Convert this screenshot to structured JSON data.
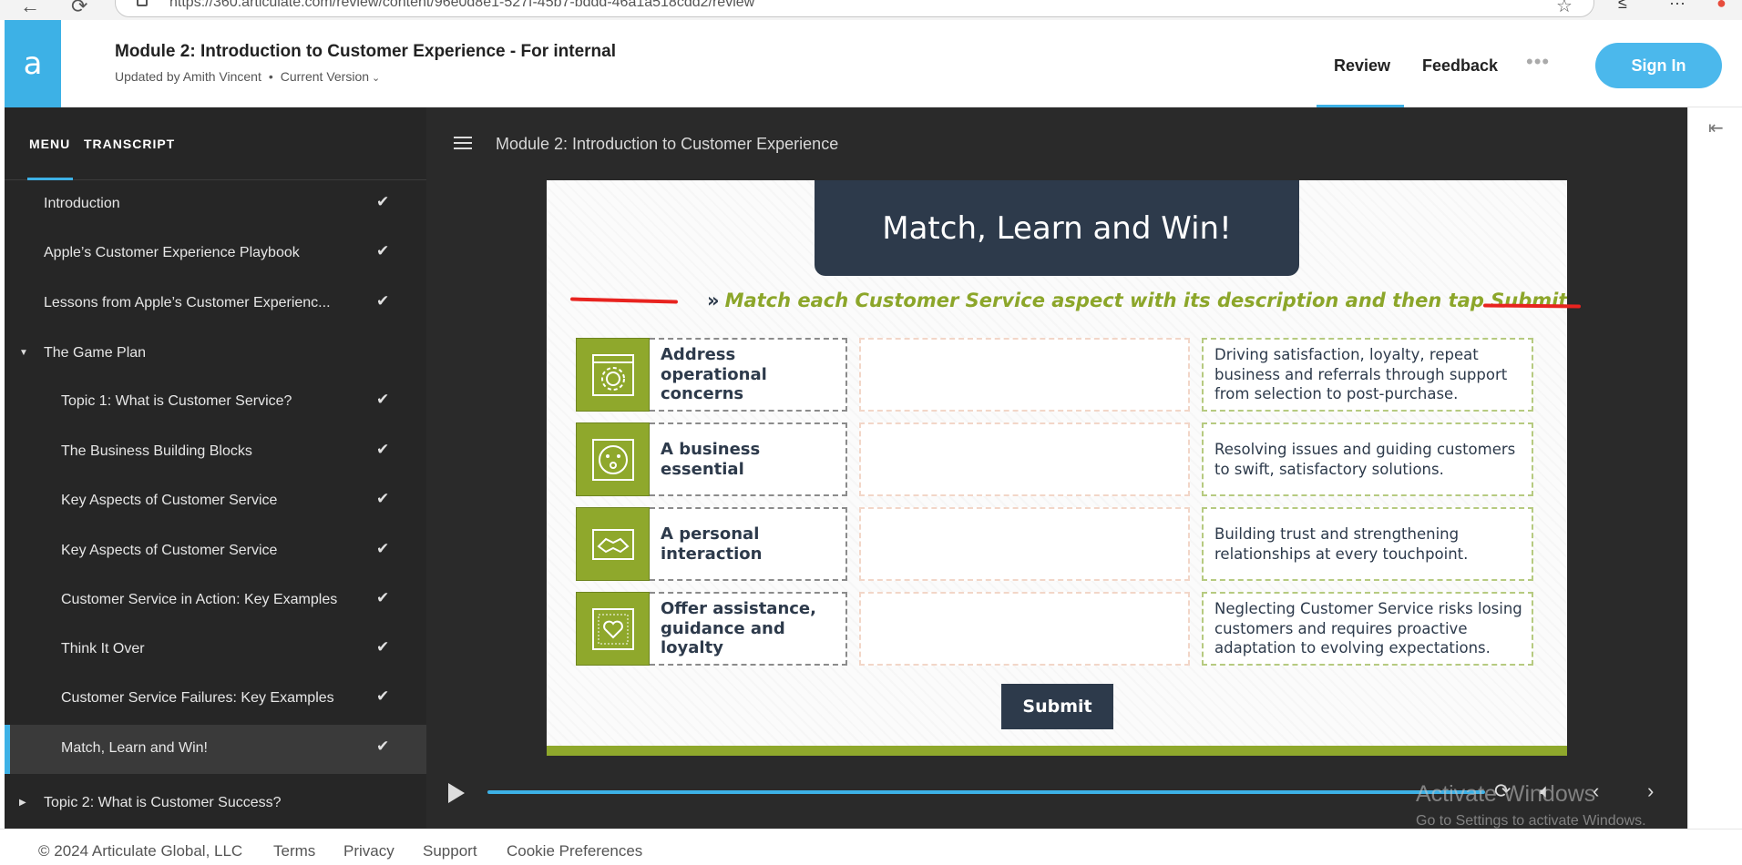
{
  "browser": {
    "url": "https://360.articulate.com/review/content/96e0d8e1-527f-45b7-bddd-46a1a518cdd2/review"
  },
  "header": {
    "logo_letter": "a",
    "course_title": "Module 2: Introduction to Customer Experience - For internal",
    "updated_by": "Updated by Amith Vincent",
    "separator": "•",
    "version": "Current Version",
    "nav": [
      "Review",
      "Feedback"
    ],
    "sign_in": "Sign In"
  },
  "sidebar": {
    "tabs": [
      "MENU",
      "TRANSCRIPT"
    ],
    "items": [
      {
        "label": "Introduction",
        "checked": true,
        "indent": 1
      },
      {
        "label": "Apple’s Customer Experience Playbook",
        "checked": true,
        "indent": 1
      },
      {
        "label": "Lessons from Apple’s Customer Experienc...",
        "checked": true,
        "indent": 1
      },
      {
        "label": "The Game Plan",
        "checked": false,
        "indent": 1,
        "expanded": true
      },
      {
        "label": "Topic 1: What is Customer Service?",
        "checked": true,
        "indent": 2
      },
      {
        "label": "The Business Building Blocks",
        "checked": true,
        "indent": 2
      },
      {
        "label": "Key Aspects of Customer Service",
        "checked": true,
        "indent": 2
      },
      {
        "label": "Key Aspects of Customer Service",
        "checked": true,
        "indent": 2
      },
      {
        "label": "Customer Service in Action: Key Examples",
        "checked": true,
        "indent": 2
      },
      {
        "label": "Think It Over",
        "checked": true,
        "indent": 2
      },
      {
        "label": "Customer Service Failures: Key Examples",
        "checked": true,
        "indent": 2
      },
      {
        "label": "Match, Learn and Win!",
        "checked": true,
        "indent": 2,
        "active": true
      },
      {
        "label": "Topic 2: What is Customer Success?",
        "checked": false,
        "indent": 1,
        "expanded": false
      }
    ]
  },
  "player": {
    "title": "Module 2: Introduction to Customer Experience"
  },
  "slide": {
    "banner": "Match, Learn and Win!",
    "instruction": "Match each Customer Service aspect with its description and then tap Submit.",
    "aspects": [
      {
        "label": "Address operational concerns",
        "icon": "gear-icon"
      },
      {
        "label": "A business essential",
        "icon": "smiley-icon"
      },
      {
        "label": "A personal interaction",
        "icon": "handshake-icon"
      },
      {
        "label": "Offer assistance, guidance and loyalty",
        "icon": "heart-icon"
      }
    ],
    "descriptions": [
      "Driving satisfaction, loyalty, repeat business and referrals through support from selection to post-purchase.",
      "Resolving issues and guiding customers to swift, satisfactory solutions.",
      "Building trust and strengthening relationships at every touchpoint.",
      "Neglecting Customer Service risks losing customers and requires proactive adaptation to evolving expectations."
    ],
    "submit": "Submit",
    "colors": {
      "accent": "#8fa82c",
      "dark": "#2d3a4b",
      "annotation": "#e8231f"
    }
  },
  "watermark": {
    "line1": "Activate Windows",
    "line2": "Go to Settings to activate Windows."
  },
  "footer": {
    "copyright": "© 2024 Articulate Global, LLC",
    "links": [
      "Terms",
      "Privacy",
      "Support",
      "Cookie Preferences"
    ]
  }
}
